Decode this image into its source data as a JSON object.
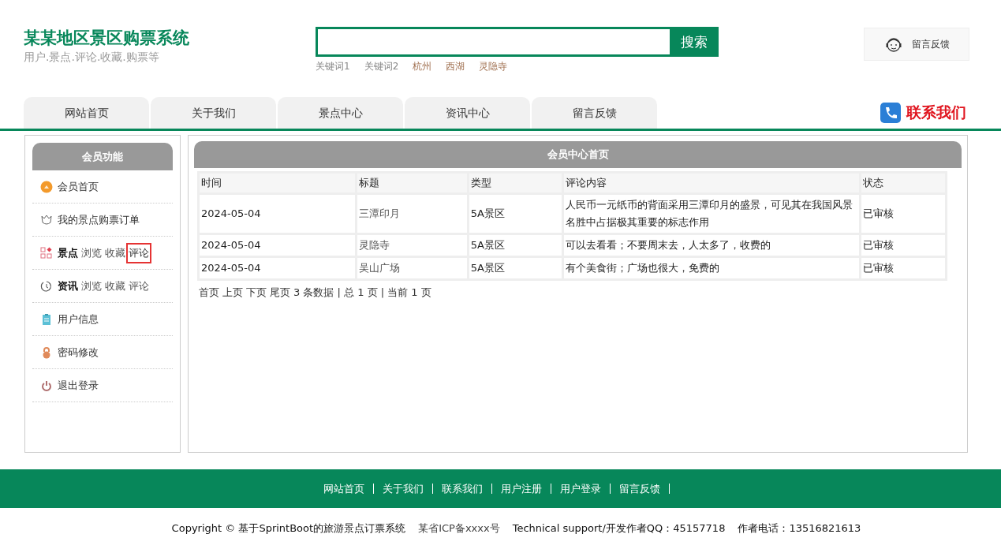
{
  "site": {
    "title": "某某地区景区购票系统",
    "subtitle": "用户.景点.评论.收藏.购票等"
  },
  "search": {
    "button": "搜索",
    "keywords": [
      "关键词1",
      "关键词2",
      "杭州",
      "西湖",
      "灵隐寺"
    ]
  },
  "feedback_button": "留言反馈",
  "nav": {
    "tabs": [
      {
        "label": "网站首页",
        "selected": false
      },
      {
        "label": "关于我们",
        "selected": false
      },
      {
        "label": "景点中心",
        "selected": false
      },
      {
        "label": "资讯中心",
        "selected": false
      },
      {
        "label": "留言反馈",
        "selected": false
      }
    ],
    "contact": "联系我们"
  },
  "sidebar": {
    "title": "会员功能",
    "items": [
      {
        "label": "会员首页"
      },
      {
        "label": "我的景点购票订单"
      },
      {
        "label": "景点",
        "links": [
          {
            "label": "浏览",
            "selected": false
          },
          {
            "label": "收藏",
            "selected": false
          },
          {
            "label": "评论",
            "selected": true
          }
        ]
      },
      {
        "label": "资讯",
        "links": [
          {
            "label": "浏览",
            "selected": false
          },
          {
            "label": "收藏",
            "selected": false
          },
          {
            "label": "评论",
            "selected": false
          }
        ]
      },
      {
        "label": "用户信息"
      },
      {
        "label": "密码修改"
      },
      {
        "label": "退出登录"
      }
    ]
  },
  "panel": {
    "title": "会员中心首页",
    "table": {
      "columns": [
        "时间",
        "标题",
        "类型",
        "评论内容",
        "状态"
      ],
      "rows": [
        [
          "2024-05-04",
          "三潭印月",
          "5A景区",
          "人民币一元纸币的背面采用三潭印月的盛景，可见其在我国风景名胜中占据极其重要的标志作用",
          "已审核"
        ],
        [
          "2024-05-04",
          "灵隐寺",
          "5A景区",
          "可以去看看；不要周末去，人太多了，收费的",
          "已审核"
        ],
        [
          "2024-05-04",
          "吴山广场",
          "5A景区",
          "有个美食街；广场也很大，免费的",
          "已审核"
        ]
      ]
    },
    "pager": [
      "首页",
      "上页",
      "下页",
      "尾页",
      "3 条数据 | 总 1 页 | 当前 1 页"
    ]
  },
  "footer": {
    "links": [
      "网站首页",
      "关于我们",
      "联系我们",
      "用户注册",
      "用户登录",
      "留言反馈"
    ],
    "copyright": "Copyright © 基于SprintBoot的旅游景点订票系统",
    "icp": "某省ICP备xxxx号",
    "support": "Technical support/开发作者QQ：45157718",
    "phone": "作者电话：13516821613"
  }
}
